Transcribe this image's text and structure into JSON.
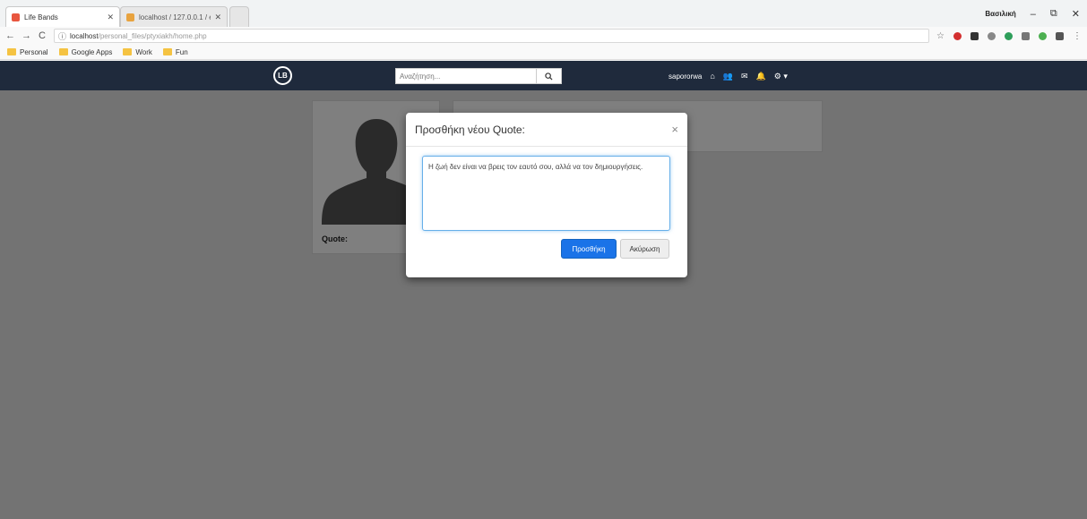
{
  "browser": {
    "tabs": [
      {
        "title": "Life Bands",
        "favicon_color": "#e8563f"
      },
      {
        "title": "localhost / 127.0.0.1 / ev",
        "favicon_color": "#e8a33f"
      }
    ],
    "user_name": "Βασιλική",
    "window_controls": {
      "minimize": "–",
      "restore": "⧉",
      "close": "✕"
    },
    "url_host": "localhost",
    "url_path": "/personal_files/ptyxiakh/home.php",
    "bookmarks": [
      "Personal",
      "Google Apps",
      "Work",
      "Fun"
    ],
    "nav_icons": {
      "back": "←",
      "forward": "→",
      "reload": "C",
      "info": "ⓘ"
    },
    "toolbar_icons": [
      "star-icon",
      "opera-icon",
      "extension-icon",
      "extension-icon",
      "extension-icon",
      "extension-icon",
      "extension-icon",
      "extension-icon",
      "menu-icon"
    ]
  },
  "site": {
    "logo_text": "LB",
    "search": {
      "placeholder": "Αναζήτηση...",
      "button_icon": "search-icon"
    },
    "username": "sapororwa",
    "nav_icons": [
      "home-icon",
      "friends-icon",
      "messages-icon",
      "notifications-icon",
      "settings-icon"
    ],
    "profile": {
      "quote_label": "Quote:"
    }
  },
  "modal": {
    "title": "Προσθήκη νέου Quote:",
    "close_label": "×",
    "textarea_value": "Η ζωή δεν είναι να βρεις τον εαυτό σου, αλλά να τον δημιουργήσεις.",
    "submit_label": "Προσθήκη",
    "cancel_label": "Ακύρωση"
  },
  "colors": {
    "navbar": "#1f2a3c",
    "primary_button": "#1a73e8",
    "overlay": "rgba(0,0,0,0.5)"
  }
}
